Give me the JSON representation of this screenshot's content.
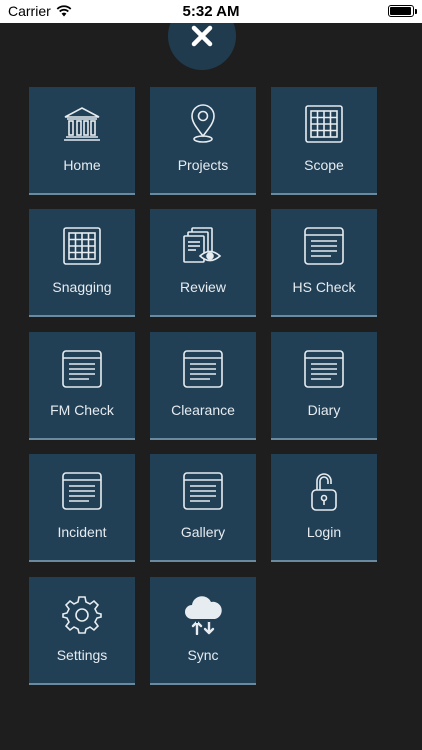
{
  "status_bar": {
    "carrier": "Carrier",
    "time": "5:32 AM"
  },
  "menu": {
    "items": [
      {
        "label": "Home",
        "icon": "home-icon"
      },
      {
        "label": "Projects",
        "icon": "location-pin-icon"
      },
      {
        "label": "Scope",
        "icon": "grid-icon"
      },
      {
        "label": "Snagging",
        "icon": "grid-icon"
      },
      {
        "label": "Review",
        "icon": "review-documents-icon"
      },
      {
        "label": "HS Check",
        "icon": "form-icon"
      },
      {
        "label": "FM Check",
        "icon": "form-icon"
      },
      {
        "label": "Clearance",
        "icon": "form-icon"
      },
      {
        "label": "Diary",
        "icon": "form-icon"
      },
      {
        "label": "Incident",
        "icon": "form-icon"
      },
      {
        "label": "Gallery",
        "icon": "form-icon"
      },
      {
        "label": "Login",
        "icon": "unlocked-padlock-icon"
      },
      {
        "label": "Settings",
        "icon": "gear-icon"
      },
      {
        "label": "Sync",
        "icon": "cloud-sync-icon"
      }
    ]
  },
  "colors": {
    "background": "#1e1e1f",
    "tile": "#213f55",
    "tile_border": "#6a8aa0",
    "close_button": "#213b4e"
  }
}
